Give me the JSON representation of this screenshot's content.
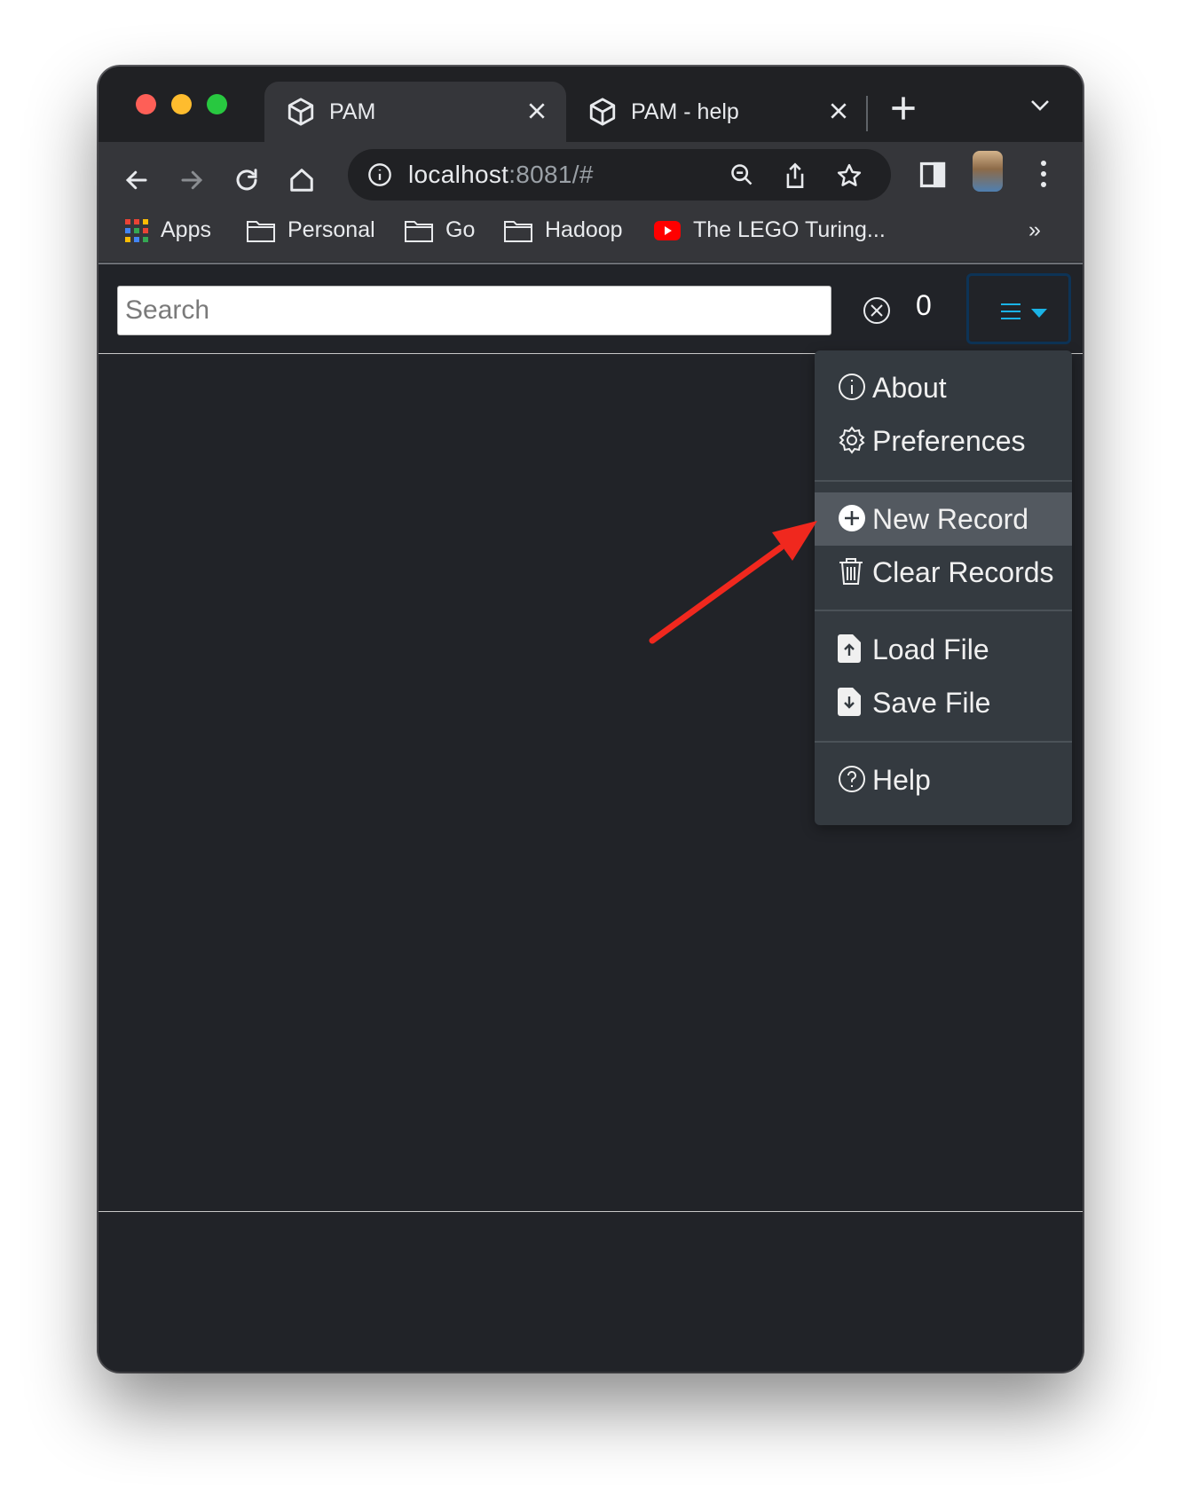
{
  "browser": {
    "tabs": [
      {
        "title": "PAM",
        "icon": "cube-icon",
        "active": true
      },
      {
        "title": "PAM - help",
        "icon": "cube-icon",
        "active": false
      }
    ],
    "address": {
      "host": "localhost",
      "rest": ":8081/#"
    },
    "bookmarks": [
      {
        "label": "Apps",
        "icon": "apps-grid-icon"
      },
      {
        "label": "Personal",
        "icon": "folder-icon"
      },
      {
        "label": "Go",
        "icon": "folder-icon"
      },
      {
        "label": "Hadoop",
        "icon": "folder-icon"
      },
      {
        "label": "The LEGO Turing...",
        "icon": "youtube-icon"
      }
    ],
    "bookmarks_overflow": "»"
  },
  "app": {
    "search": {
      "placeholder": "Search",
      "value": ""
    },
    "record_count": "0",
    "accent_color": "#1ab3e6",
    "menu": {
      "groups": [
        [
          {
            "label": "About",
            "icon": "info-circle-icon"
          },
          {
            "label": "Preferences",
            "icon": "gear-icon"
          }
        ],
        [
          {
            "label": "New Record",
            "icon": "plus-circle-icon",
            "highlighted": true
          },
          {
            "label": "Clear Records",
            "icon": "trash-icon"
          }
        ],
        [
          {
            "label": "Load File",
            "icon": "file-upload-icon"
          },
          {
            "label": "Save File",
            "icon": "file-download-icon"
          }
        ],
        [
          {
            "label": "Help",
            "icon": "question-circle-icon"
          }
        ]
      ]
    }
  },
  "annotation": {
    "arrow_color": "#f0281e"
  }
}
